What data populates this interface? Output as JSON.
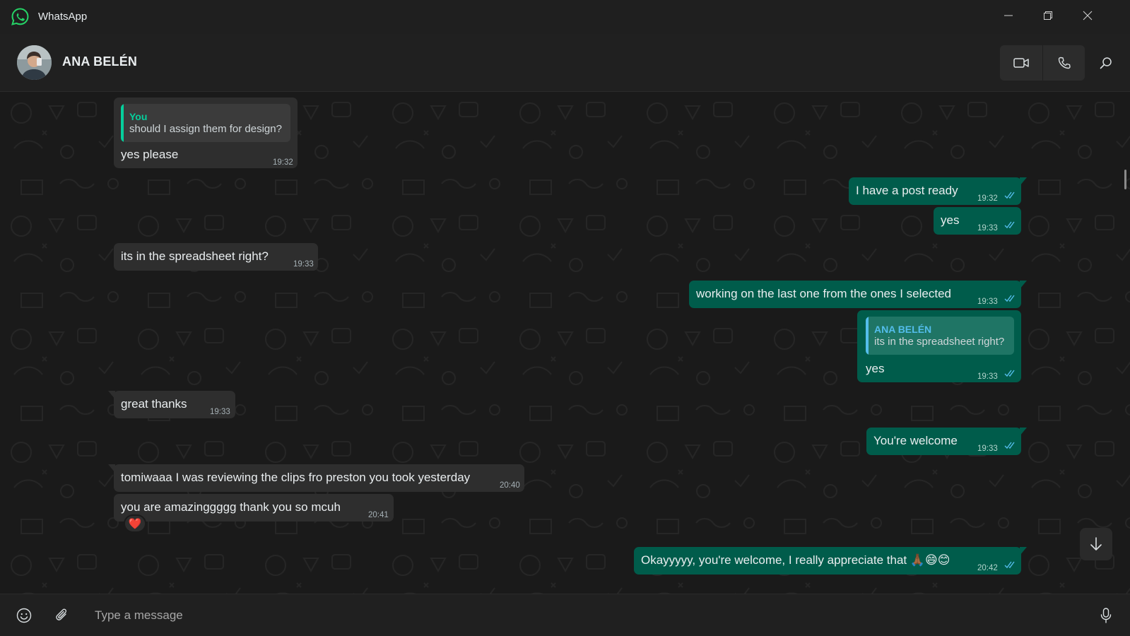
{
  "window": {
    "title": "WhatsApp",
    "controls": [
      "minimize-icon",
      "restore-icon",
      "close-icon"
    ]
  },
  "header": {
    "contact_name": "ANA BELÉN",
    "actions": [
      "video-call-icon",
      "voice-call-icon",
      "search-icon"
    ]
  },
  "messages": [
    {
      "dir": "in",
      "text": "yes please",
      "time": "19:32",
      "quote": {
        "author": "You",
        "text": "should I assign them for design?"
      }
    },
    {
      "dir": "out",
      "text": "I have a post ready",
      "time": "19:32",
      "status": "read"
    },
    {
      "dir": "out",
      "text": "yes",
      "time": "19:33",
      "status": "read"
    },
    {
      "dir": "in",
      "text": "its in the spreadsheet right?",
      "time": "19:33"
    },
    {
      "dir": "out",
      "text": "working on the last one from the ones I selected",
      "time": "19:33",
      "status": "read"
    },
    {
      "dir": "out",
      "text": "yes",
      "time": "19:33",
      "status": "read",
      "quote": {
        "author": "ANA BELÉN",
        "text": "its in the spreadsheet right?"
      }
    },
    {
      "dir": "in",
      "text": "great thanks",
      "time": "19:33"
    },
    {
      "dir": "out",
      "text": "You're welcome",
      "time": "19:33",
      "status": "read"
    },
    {
      "dir": "in",
      "text": "tomiwaaa I was reviewing the clips fro preston you took yesterday",
      "time": "20:40"
    },
    {
      "dir": "in",
      "text": "you are amazinggggg thank you so mcuh",
      "time": "20:41",
      "reaction": "❤️"
    },
    {
      "dir": "out",
      "text": "Okayyyyy, you're welcome, I really appreciate that 🙏🏾😄😊",
      "time": "20:42",
      "status": "read"
    }
  ],
  "composer": {
    "placeholder": "Type a message"
  },
  "colors": {
    "accent_green": "#25d366",
    "outgoing_bubble": "#005c4b",
    "incoming_bubble": "#2e2e2e",
    "read_ticks": "#53bdeb",
    "quote_you": "#06cf9c",
    "quote_contact": "#53bdeb"
  }
}
